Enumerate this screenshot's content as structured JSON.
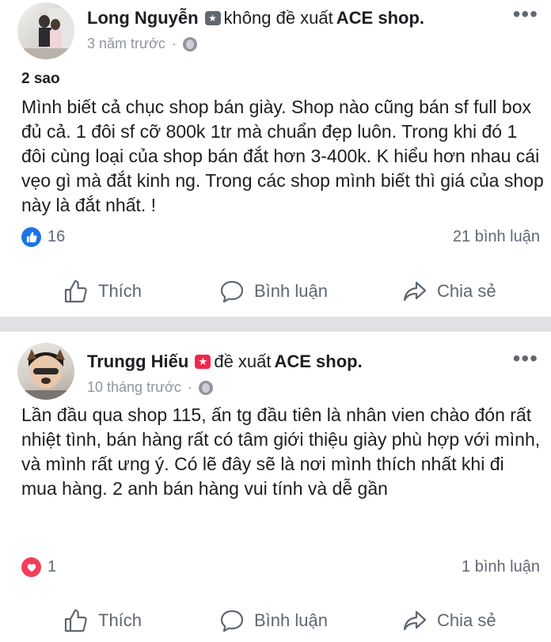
{
  "posts": [
    {
      "author": "Long Nguyễn",
      "action": "không đề xuất",
      "page": "ACE shop.",
      "recommend": false,
      "time": "3 năm trước",
      "dot": "·",
      "rating": "2 sao",
      "body": "Mình biết cả chục shop bán giày. Shop nào cũng bán sf full box đủ cả. 1 đôi sf cỡ 800k 1tr mà chuẩn đẹp luôn. Trong khi đó 1 đôi cùng loại của shop bán đắt hơn 3-400k. K hiểu hơn nhau cái vẹo gì mà đắt kinh ng. Trong các shop mình biết thì giá của shop này là đắt nhất. !",
      "reaction_icon": "like-icon",
      "reaction_count": "16",
      "comments": "21 bình luận",
      "badge_color": "#606770"
    },
    {
      "author": "Trungg Hiếu",
      "action": "đề xuất",
      "page": "ACE shop.",
      "recommend": true,
      "time": "10 tháng trước",
      "dot": "·",
      "body": "Lần đầu qua shop 115, ấn tg đầu tiên là nhân vien chào đón rất nhiệt tình, bán hàng rất có tâm giới thiệu giày phù hợp với mình, và mình rất ưng ý. Có lẽ đây sẽ là nơi mình thích nhất khi đi mua hàng. 2 anh bán hàng vui tính và dễ gần",
      "reaction_icon": "heart-icon",
      "reaction_count": "1",
      "comments": "1 bình luận",
      "badge_color": "#f0284a"
    }
  ],
  "actions": {
    "like": "Thích",
    "comment": "Bình luận",
    "share": "Chia sẻ"
  },
  "more": "•••",
  "colors": {
    "like_blue": "#1b74e4",
    "heart_red": "#f33e58",
    "separator": "#dfe1e5",
    "muted_text": "#606770"
  }
}
